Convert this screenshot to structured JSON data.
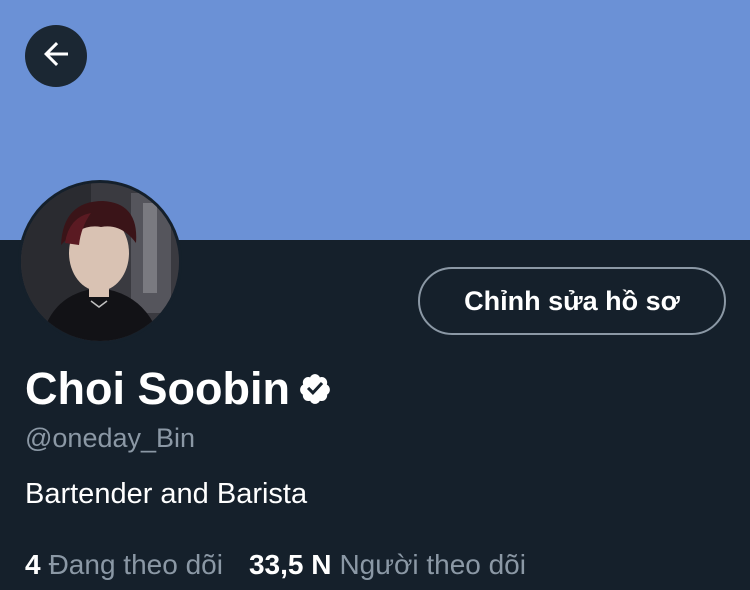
{
  "header": {
    "back_icon": "arrow-left-icon",
    "banner_color": "#6b91d6"
  },
  "profile": {
    "display_name": "Choi Soobin",
    "verified_icon": "verified-badge-icon",
    "handle": "@oneday_Bin",
    "bio": "Bartender and Barista",
    "edit_button_label": "Chỉnh sửa hồ sơ"
  },
  "stats": {
    "following_count": "4",
    "following_label": "Đang theo dõi",
    "followers_count": "33,5 N",
    "followers_label": "Người theo dõi"
  },
  "colors": {
    "background": "#15202b",
    "secondary_text": "#8b98a5",
    "primary_text": "#ffffff"
  }
}
